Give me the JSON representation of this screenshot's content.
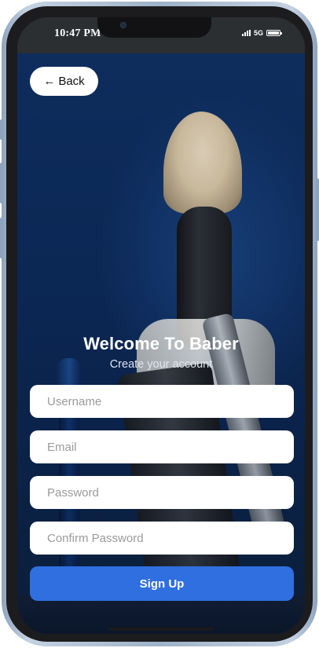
{
  "status_bar": {
    "time": "10:47 PM",
    "network": "5G",
    "battery_level": 1.0
  },
  "header": {
    "back_label": "Back",
    "back_icon": "left-arrow-icon",
    "back_glyph": "←"
  },
  "hero": {
    "title": "Welcome To Baber",
    "subtitle": "Create your account"
  },
  "form": {
    "username": {
      "value": "",
      "placeholder": "Username"
    },
    "email": {
      "value": "",
      "placeholder": "Email"
    },
    "password": {
      "value": "",
      "placeholder": "Password"
    },
    "confirm_password": {
      "value": "",
      "placeholder": "Confirm Password"
    },
    "submit_label": "Sign Up"
  },
  "colors": {
    "accent": "#2f6fe0",
    "background": "#0c2650",
    "field_bg": "#ffffff"
  }
}
